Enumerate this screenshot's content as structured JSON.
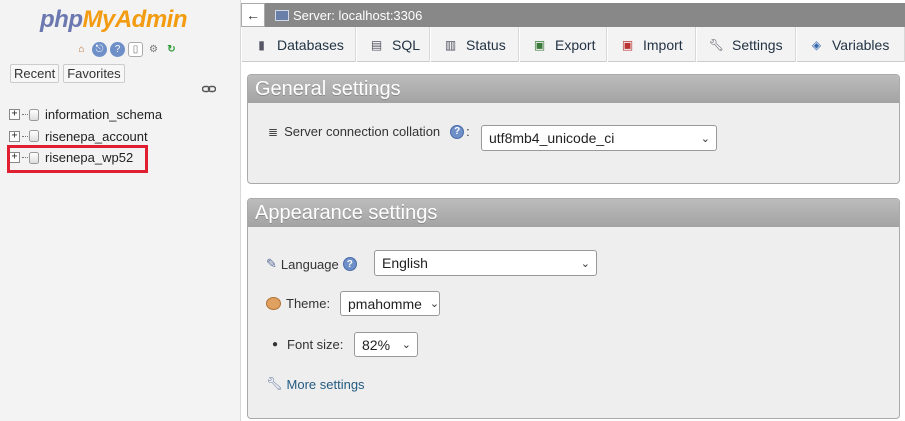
{
  "logo": {
    "php": "php",
    "admin": "MyAdmin"
  },
  "nav_buttons": {
    "recent": "Recent",
    "favorites": "Favorites"
  },
  "databases": [
    "information_schema",
    "risenepa_account",
    "risenepa_wp52"
  ],
  "topbar": {
    "back": "←",
    "server": "Server: localhost:3306"
  },
  "tabs": [
    {
      "label": "Databases",
      "icon": "database-icon"
    },
    {
      "label": "SQL",
      "icon": "sql-icon"
    },
    {
      "label": "Status",
      "icon": "status-icon"
    },
    {
      "label": "Export",
      "icon": "export-icon"
    },
    {
      "label": "Import",
      "icon": "import-icon"
    },
    {
      "label": "Settings",
      "icon": "wrench-icon"
    },
    {
      "label": "Variables",
      "icon": "variables-icon"
    }
  ],
  "general": {
    "title": "General settings",
    "collation_label": "Server connection collation",
    "collation_colon": ":",
    "collation_value": "utf8mb4_unicode_ci"
  },
  "appearance": {
    "title": "Appearance settings",
    "language_label": "Language",
    "language_value": "English",
    "theme_label": "Theme:",
    "theme_value": "pmahomme",
    "fontsize_label": "Font size:",
    "fontsize_value": "82%",
    "more_settings": "More settings"
  },
  "colors": {
    "highlight": "#e02030",
    "logo_php": "#6c78b0",
    "logo_admin": "#f39c12",
    "topbar": "#888888"
  }
}
